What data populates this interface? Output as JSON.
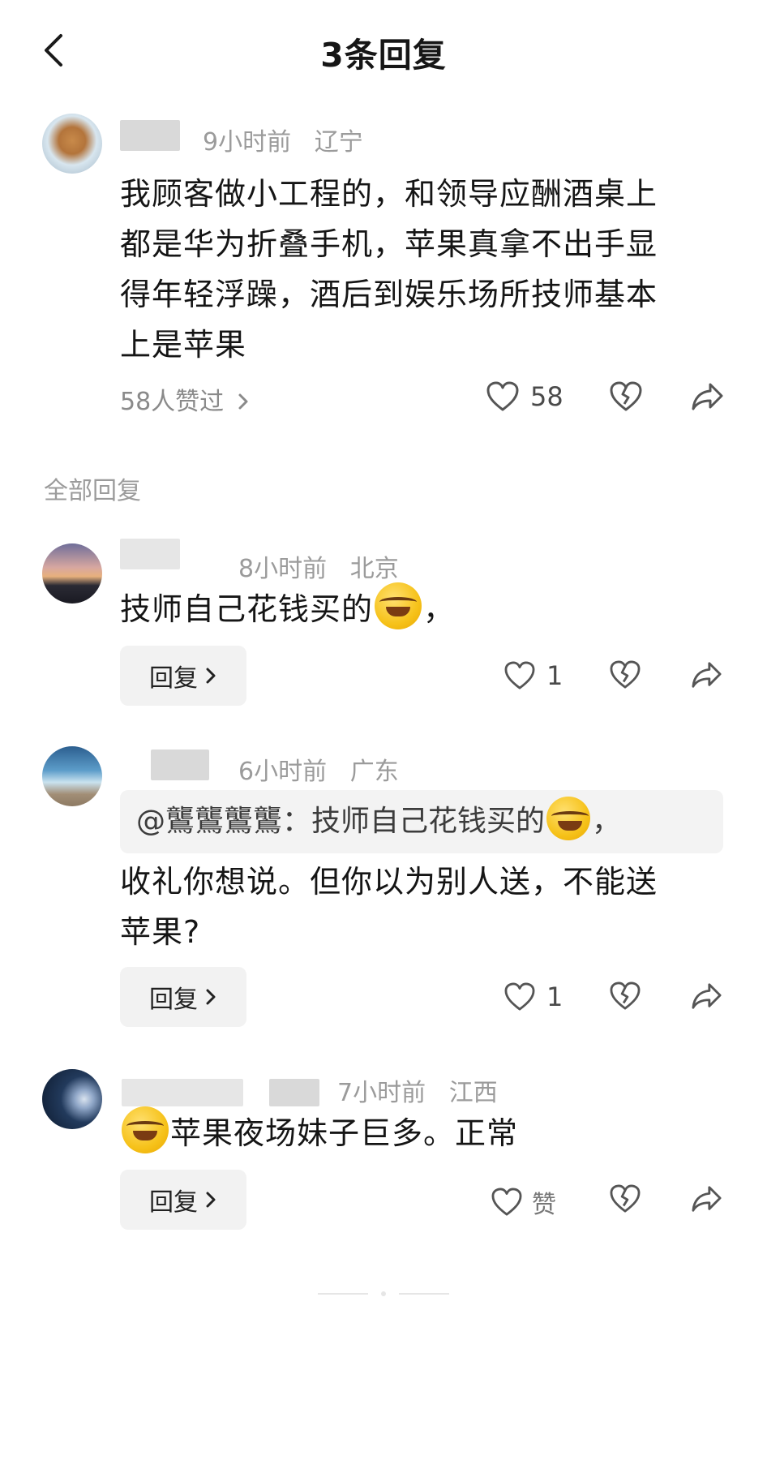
{
  "header": {
    "title": "3条回复"
  },
  "main_comment": {
    "time": "9小时前",
    "location": "辽宁",
    "text_lines": [
      "我顾客做小工程的，和领导应酬酒桌上",
      "都是华为折叠手机，苹果真拿不出手显",
      "得年轻浮躁，酒后到娱乐场所技师基本",
      "上是苹果"
    ],
    "likes_text": "58人赞过",
    "like_count": "58"
  },
  "section_label": "全部回复",
  "replies": [
    {
      "time": "8小时前",
      "location": "北京",
      "text_before_emoji": "技师自己花钱买的",
      "text_after_emoji": "，",
      "reply_label": "回复",
      "like_count": "1"
    },
    {
      "time": "6小时前",
      "location": "广东",
      "quote_prefix": "@鸗鸗鸗鸗：技师自己花钱买的",
      "quote_suffix": "，",
      "text_lines": [
        "收礼你想说。但你以为别人送，不能送",
        "苹果?"
      ],
      "reply_label": "回复",
      "like_count": "1"
    },
    {
      "time": "7小时前",
      "location": "江西",
      "text_after_emoji": "苹果夜场妹子巨多。正常",
      "reply_label": "回复",
      "like_label": "赞"
    }
  ],
  "icons": [
    "back-icon",
    "heart-icon",
    "broken-heart-icon",
    "share-icon",
    "chevron-right-icon"
  ]
}
